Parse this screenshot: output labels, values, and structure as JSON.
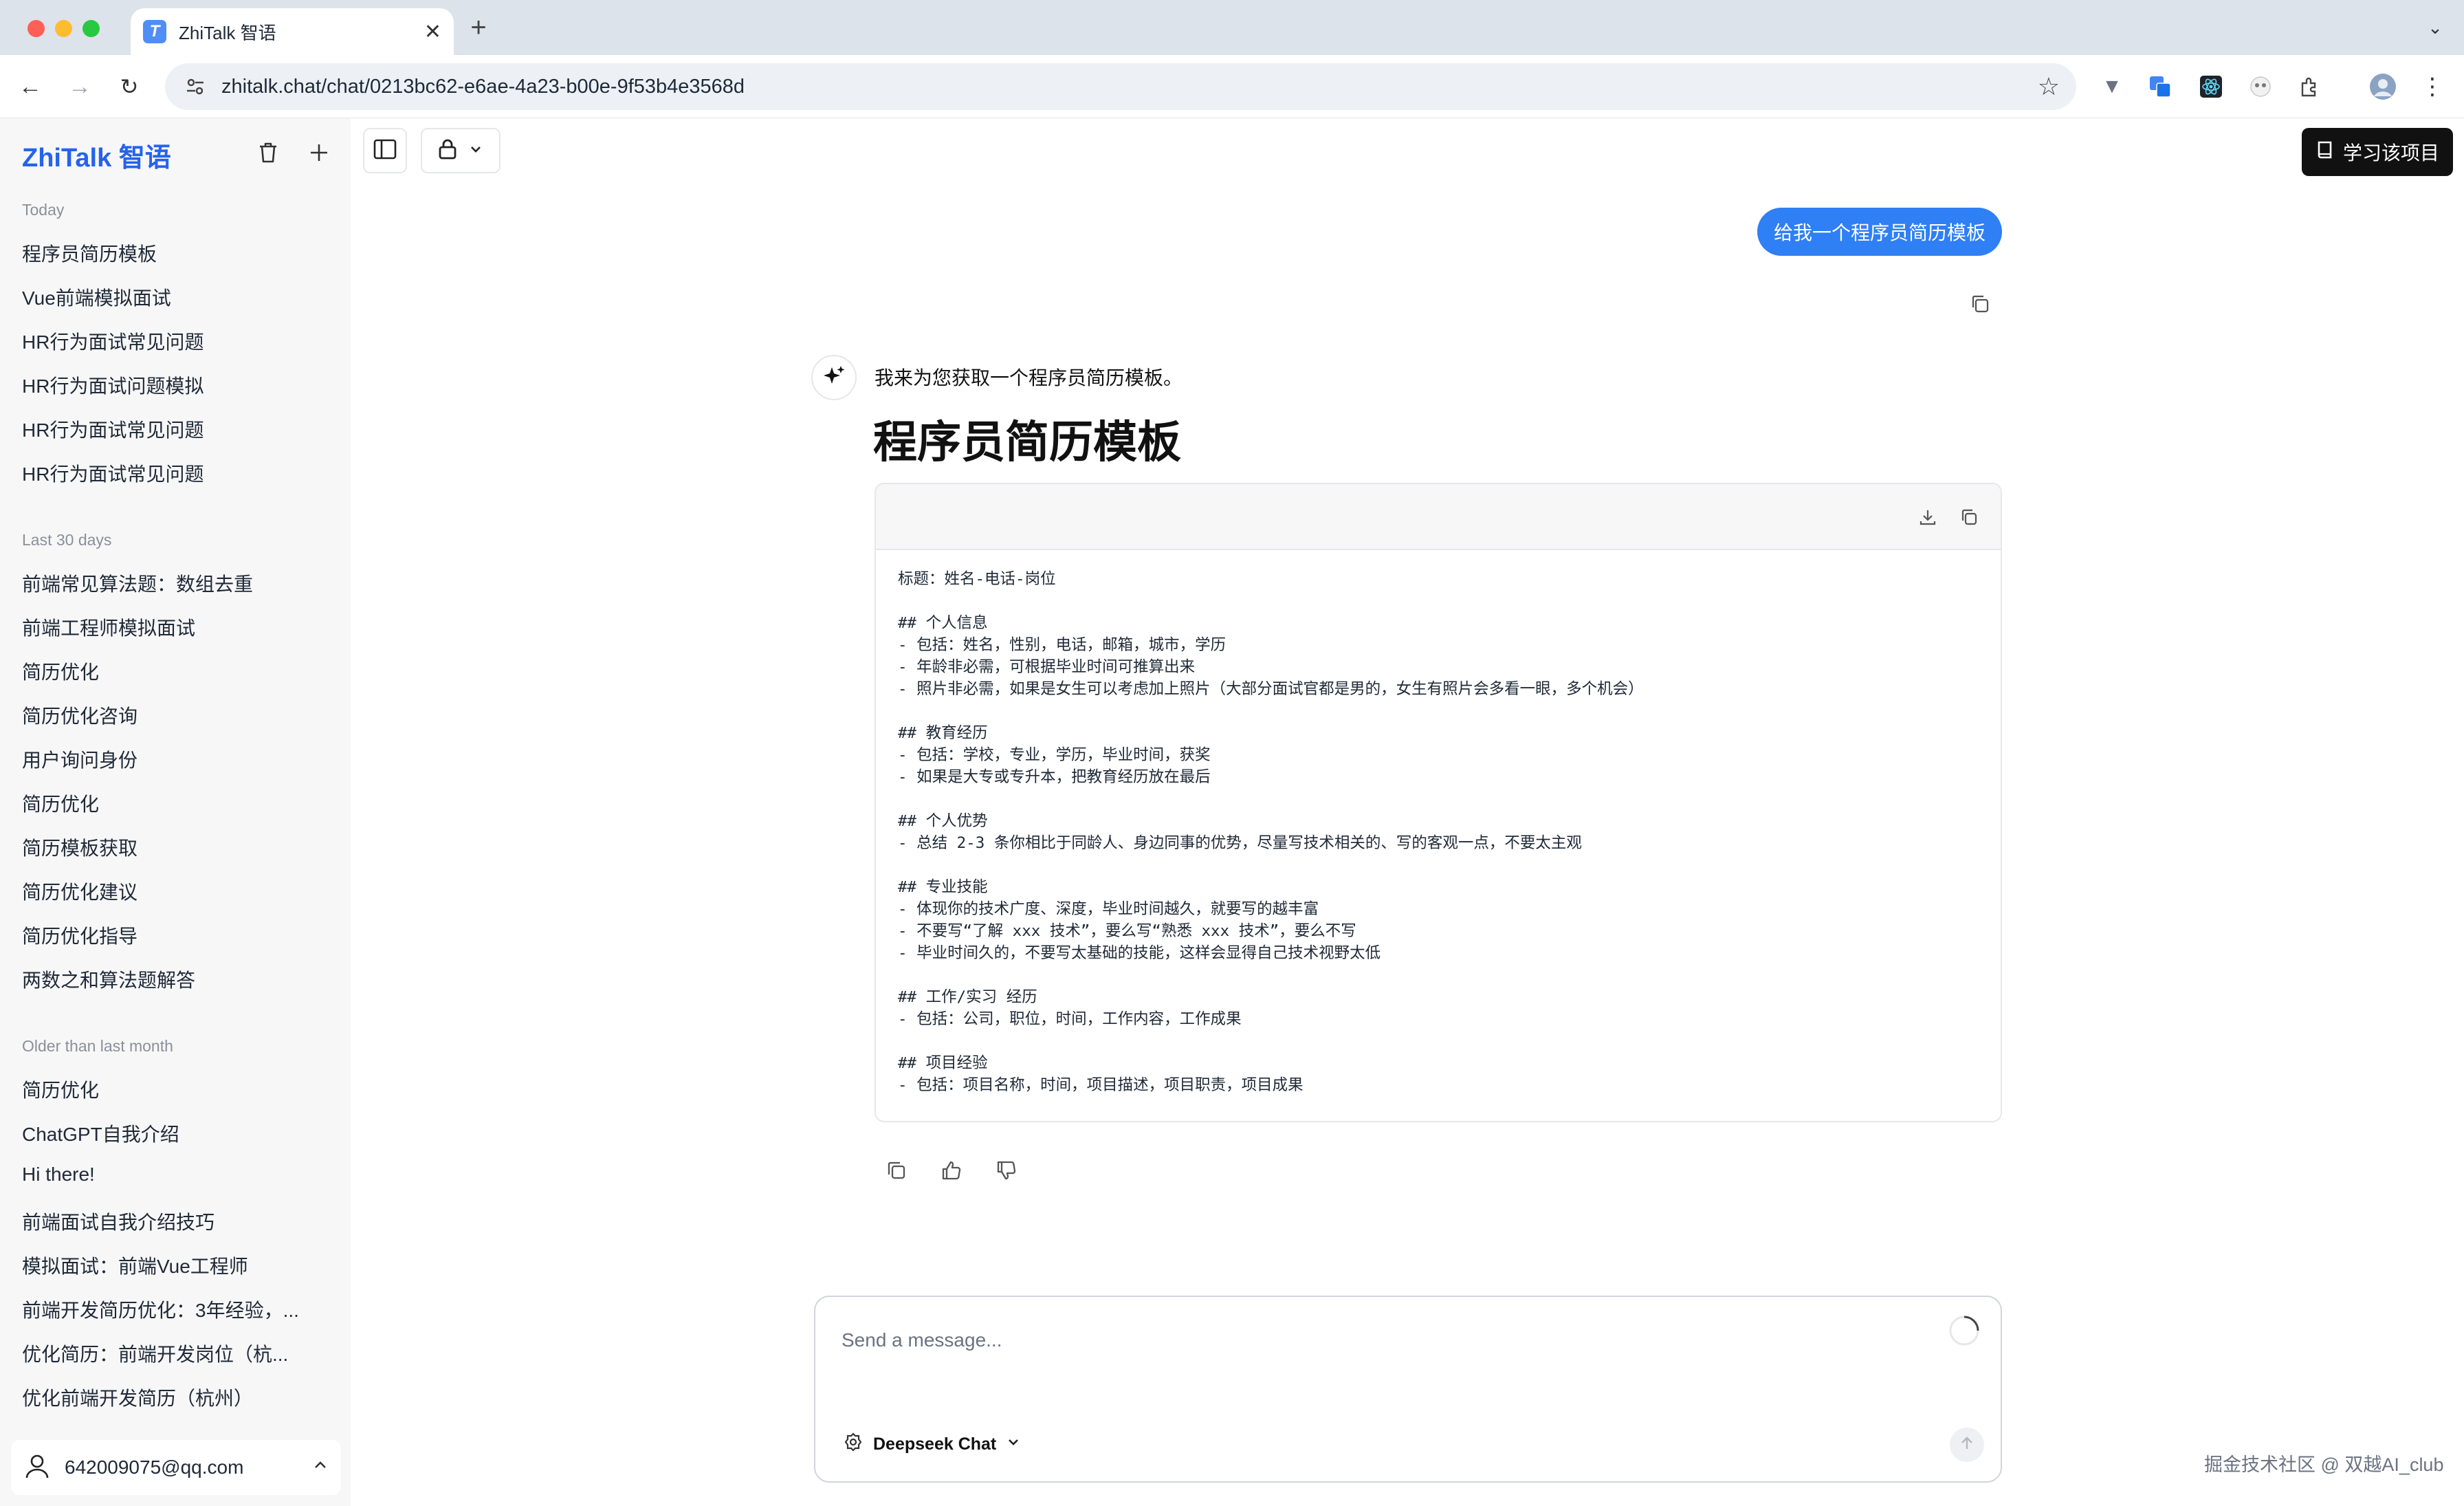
{
  "browser": {
    "tab_title": "ZhiTalk 智语",
    "tab_favicon": "T",
    "url": "zhitalk.chat/chat/0213bc62-e6ae-4a23-b00e-9f53b4e3568d",
    "new_tab": "+",
    "close": "✕"
  },
  "sidebar": {
    "brand": "ZhiTalk 智语",
    "groups": [
      {
        "label": "Today",
        "items": [
          "程序员简历模板",
          "Vue前端模拟面试",
          "HR行为面试常见问题",
          "HR行为面试问题模拟",
          "HR行为面试常见问题",
          "HR行为面试常见问题"
        ]
      },
      {
        "label": "Last 30 days",
        "items": [
          "前端常见算法题：数组去重",
          "前端工程师模拟面试",
          "简历优化",
          "简历优化咨询",
          "用户询问身份",
          "简历优化",
          "简历模板获取",
          "简历优化建议",
          "简历优化指导",
          "两数之和算法题解答"
        ]
      },
      {
        "label": "Older than last month",
        "items": [
          "简历优化",
          "ChatGPT自我介绍",
          "Hi there!",
          "前端面试自我介绍技巧",
          "模拟面试：前端Vue工程师",
          "前端开发简历优化：3年经验，...",
          "优化简历：前端开发岗位（杭...",
          "优化前端开发简历（杭州）"
        ]
      }
    ],
    "user_email": "642009075@qq.com"
  },
  "header": {
    "learn_button": "学习该项目"
  },
  "chat": {
    "user_message": "给我一个程序员简历模板",
    "ai_intro": "我来为您获取一个程序员简历模板。",
    "doc_title": "程序员简历模板",
    "doc_lines": [
      "标题：姓名-电话-岗位",
      "",
      "## 个人信息",
      "- 包括：姓名，性别，电话，邮箱，城市，学历",
      "- 年龄非必需，可根据毕业时间可推算出来",
      "- 照片非必需，如果是女生可以考虑加上照片（大部分面试官都是男的，女生有照片会多看一眼，多个机会）",
      "",
      "## 教育经历",
      "- 包括：学校，专业，学历，毕业时间，获奖",
      "- 如果是大专或专升本，把教育经历放在最后",
      "",
      "## 个人优势",
      "- 总结 2-3 条你相比于同龄人、身边同事的优势，尽量写技术相关的、写的客观一点，不要太主观",
      "",
      "## 专业技能",
      "- 体现你的技术广度、深度，毕业时间越久，就要写的越丰富",
      "- 不要写“了解 xxx 技术”，要么写“熟悉 xxx 技术”，要么不写",
      "- 毕业时间久的，不要写太基础的技能，这样会显得自己技术视野太低",
      "",
      "## 工作/实习 经历",
      "- 包括：公司，职位，时间，工作内容，工作成果",
      "",
      "## 项目经验",
      "- 包括：项目名称，时间，项目描述，项目职责，项目成果"
    ]
  },
  "composer": {
    "placeholder": "Send a message...",
    "model": "Deepseek Chat"
  },
  "watermark": "掘金技术社区 @ 双越AI_club",
  "colors": {
    "brand": "#2563eb",
    "user_bubble": "#2f7ff5",
    "sidebar_bg": "#f7f7f8",
    "dark_button": "#111111"
  },
  "icons": [
    "trash-icon",
    "plus-icon",
    "sidebar-panel-icon",
    "lock-icon",
    "book-icon",
    "copy-icon",
    "download-icon",
    "thumbs-up-icon",
    "thumbs-down-icon",
    "sparkles-icon",
    "user-icon",
    "chevron-up-icon",
    "spinner-icon",
    "model-icon",
    "arrow-up-icon"
  ]
}
